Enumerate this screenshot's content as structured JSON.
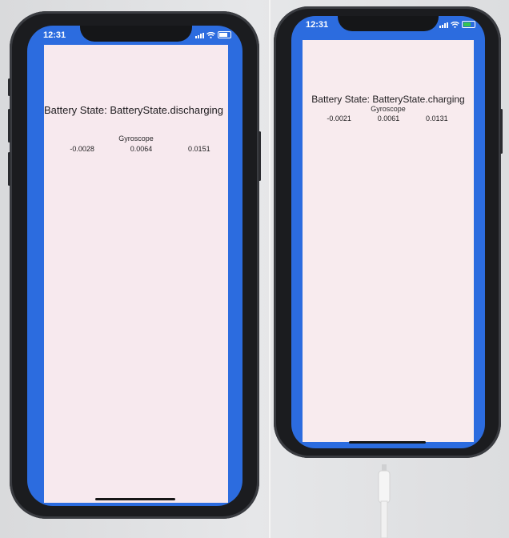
{
  "left_phone": {
    "status_time": "12:31",
    "battery_state": "Battery State: BatteryState.discharging",
    "gyroscope_label": "Gyroscope",
    "gyroscope_values": [
      "-0.0028",
      "0.0064",
      "0.0151"
    ],
    "charging": false
  },
  "right_phone": {
    "status_time": "12:31",
    "battery_state": "Battery State: BatteryState.charging",
    "gyroscope_label": "Gyroscope",
    "gyroscope_values": [
      "-0.0021",
      "0.0061",
      "0.0131"
    ],
    "charging": true
  },
  "colors": {
    "screen_blue": "#2c6cdf",
    "app_background": "#f7e9ee",
    "phone_frame": "#1b1c1f"
  }
}
